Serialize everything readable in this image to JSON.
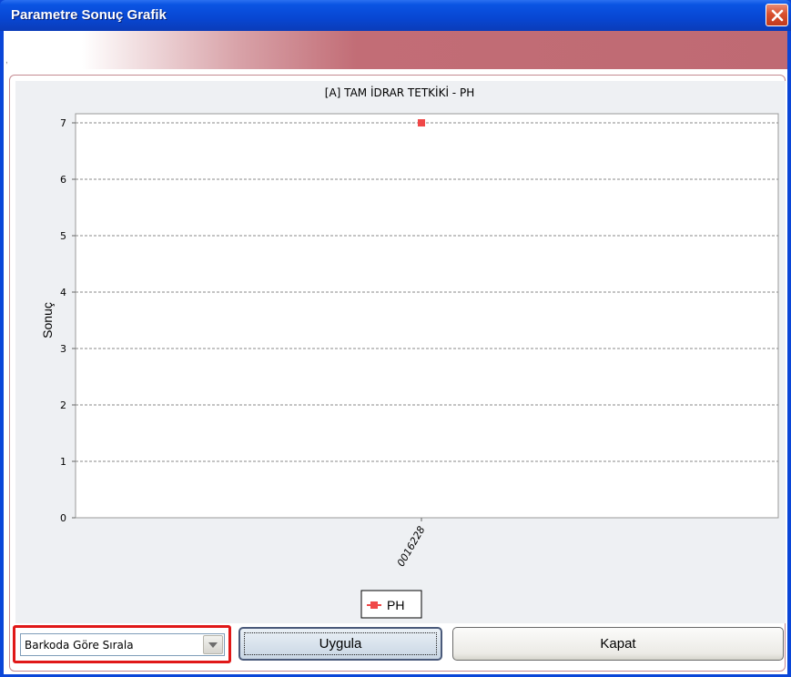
{
  "window": {
    "title": "Parametre Sonuç Grafik",
    "close_icon": "close-icon"
  },
  "chart_data": {
    "type": "scatter",
    "title": "[A] TAM İDRAR TETKİKİ - PH",
    "xlabel": "",
    "ylabel": "Sonuç",
    "categories": [
      "0016228"
    ],
    "series": [
      {
        "name": "PH",
        "values": [
          7
        ],
        "color": "#f04848"
      }
    ],
    "ylim": [
      0,
      7
    ],
    "yticks": [
      "0",
      "1",
      "2",
      "3",
      "4",
      "5",
      "6",
      "7"
    ],
    "grid": true,
    "legend": "bottom-center"
  },
  "controls": {
    "sort_select": {
      "value": "Barkoda Göre Sırala"
    },
    "apply_label": "Uygula",
    "close_label": "Kapat"
  }
}
